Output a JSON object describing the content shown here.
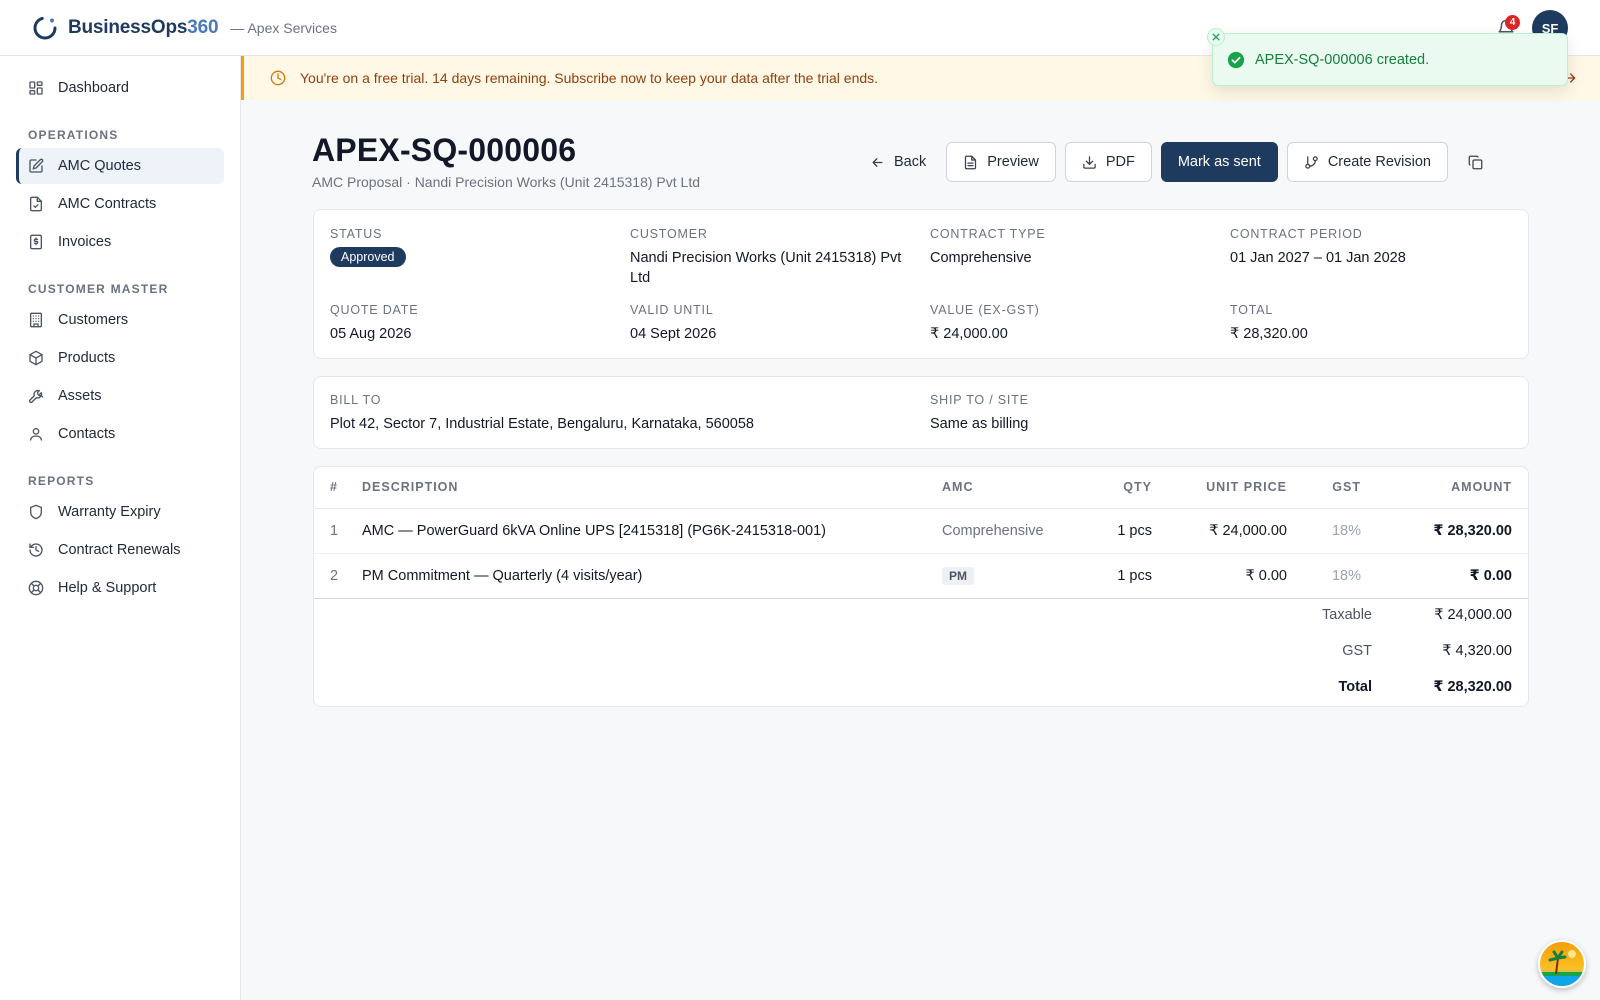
{
  "brand": {
    "name": "BusinessOps",
    "name_num": "360",
    "org": "— Apex Services"
  },
  "header": {
    "notifications_count": "4",
    "avatar_initials": "SF"
  },
  "sidebar": {
    "top_items": [
      {
        "label": "Dashboard",
        "icon": "dashboard-icon"
      }
    ],
    "sections": [
      {
        "title": "OPERATIONS",
        "items": [
          {
            "label": "AMC Quotes",
            "icon": "quote-edit-icon",
            "active": true
          },
          {
            "label": "AMC Contracts",
            "icon": "contract-file-icon"
          },
          {
            "label": "Invoices",
            "icon": "invoice-icon"
          }
        ]
      },
      {
        "title": "CUSTOMER MASTER",
        "items": [
          {
            "label": "Customers",
            "icon": "building-icon"
          },
          {
            "label": "Products",
            "icon": "package-icon"
          },
          {
            "label": "Assets",
            "icon": "wrench-icon"
          },
          {
            "label": "Contacts",
            "icon": "user-icon"
          }
        ]
      },
      {
        "title": "REPORTS",
        "items": [
          {
            "label": "Warranty Expiry",
            "icon": "shield-icon"
          },
          {
            "label": "Contract Renewals",
            "icon": "history-icon"
          },
          {
            "label": "Help & Support",
            "icon": "lifebuoy-icon"
          }
        ]
      }
    ]
  },
  "banner": {
    "text": "You're on a free trial. 14 days remaining. Subscribe now to keep your data after the trial ends."
  },
  "toast": {
    "text": "APEX-SQ-000006 created."
  },
  "page": {
    "title": "APEX-SQ-000006",
    "subtitle": "AMC Proposal · Nandi Precision Works (Unit 2415318) Pvt Ltd"
  },
  "actions": {
    "back": "Back",
    "preview": "Preview",
    "pdf": "PDF",
    "mark_sent": "Mark as sent",
    "create_revision": "Create Revision"
  },
  "summary": {
    "status_label": "STATUS",
    "status_value": "Approved",
    "customer_label": "CUSTOMER",
    "customer_value": "Nandi Precision Works (Unit 2415318) Pvt Ltd",
    "contract_type_label": "CONTRACT TYPE",
    "contract_type_value": "Comprehensive",
    "contract_period_label": "CONTRACT PERIOD",
    "contract_period_value": "01 Jan 2027 – 01 Jan 2028",
    "quote_date_label": "QUOTE DATE",
    "quote_date_value": "05 Aug 2026",
    "valid_until_label": "VALID UNTIL",
    "valid_until_value": "04 Sept 2026",
    "value_label": "VALUE (EX-GST)",
    "value_value": "₹ 24,000.00",
    "total_label": "TOTAL",
    "total_value": "₹ 28,320.00"
  },
  "address": {
    "bill_to_label": "BILL TO",
    "bill_to_value": "Plot 42, Sector 7, Industrial Estate, Bengaluru, Karnataka, 560058",
    "ship_to_label": "SHIP TO / SITE",
    "ship_to_value": "Same as billing"
  },
  "items": {
    "headers": {
      "num": "#",
      "description": "DESCRIPTION",
      "amc": "AMC",
      "qty": "QTY",
      "unit_price": "UNIT PRICE",
      "gst": "GST",
      "amount": "AMOUNT"
    },
    "rows": [
      {
        "num": "1",
        "description": "AMC — PowerGuard 6kVA Online UPS [2415318] (PG6K-2415318-001)",
        "amc": "Comprehensive",
        "qty": "1 pcs",
        "unit_price": "₹ 24,000.00",
        "gst": "18%",
        "amount": "₹ 28,320.00"
      },
      {
        "num": "2",
        "description": "PM Commitment — Quarterly (4 visits/year)",
        "amc": "PM",
        "qty": "1 pcs",
        "unit_price": "₹ 0.00",
        "gst": "18%",
        "amount": "₹ 0.00"
      }
    ],
    "totals": {
      "taxable_label": "Taxable",
      "taxable_value": "₹ 24,000.00",
      "gst_label": "GST",
      "gst_value": "₹ 4,320.00",
      "total_label": "Total",
      "total_value": "₹ 28,320.00"
    }
  }
}
